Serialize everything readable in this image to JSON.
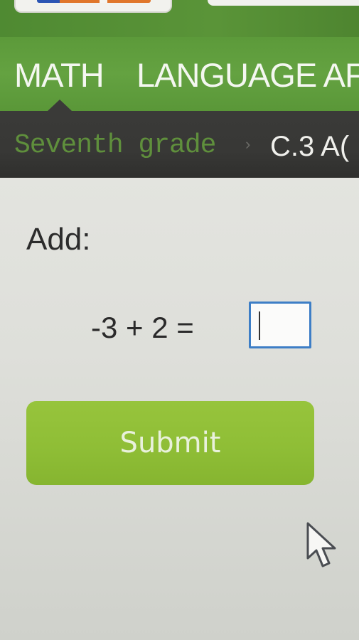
{
  "subject_nav": {
    "tabs": [
      {
        "label": "MATH",
        "active": true
      },
      {
        "label": "LANGUAGE AF",
        "active": false
      }
    ]
  },
  "breadcrumb": {
    "grade": "Seventh grade",
    "separator": "›",
    "skill": "C.3 A("
  },
  "question": {
    "prompt": "Add:",
    "equation": "-3 + 2 =",
    "answer": {
      "value": "",
      "placeholder": ""
    }
  },
  "submit_button": {
    "label": "Submit"
  },
  "colors": {
    "nav_green": "#62a040",
    "breadcrumb_bg": "#3a3a38",
    "submit_green": "#8fbe36",
    "input_border": "#3d7ec6"
  },
  "icons": {
    "cursor": "mouse-pointer-icon"
  }
}
